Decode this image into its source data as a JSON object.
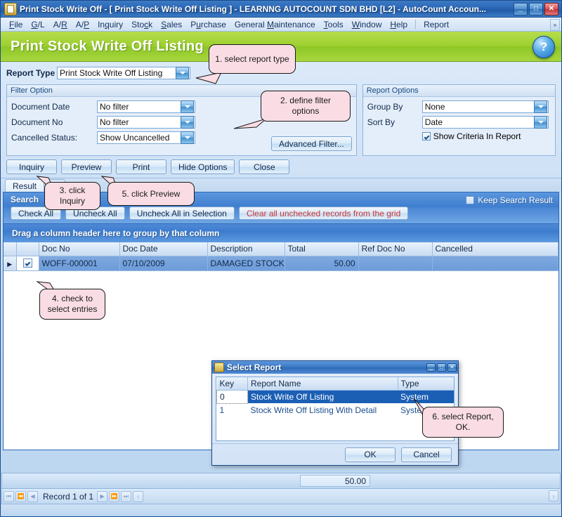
{
  "window": {
    "title": "Print Stock Write Off - [ Print Stock Write Off Listing ] - LEARNNG AUTOCOUNT SDN BHD [L2] - AutoCount Accoun...",
    "icon": "app-document-icon",
    "minimize_label": "_",
    "maximize_label": "□",
    "close_label": "✕"
  },
  "menubar": {
    "items": [
      {
        "label": "File",
        "accel": "F"
      },
      {
        "label": "G/L",
        "accel": "G"
      },
      {
        "label": "A/R",
        "accel": "R"
      },
      {
        "label": "A/P",
        "accel": "P"
      },
      {
        "label": "Inquiry",
        "accel": "q"
      },
      {
        "label": "Stock",
        "accel": "c"
      },
      {
        "label": "Sales",
        "accel": "S"
      },
      {
        "label": "Purchase",
        "accel": "u"
      },
      {
        "label": "General Maintenance",
        "accel": "M"
      },
      {
        "label": "Tools",
        "accel": "T"
      },
      {
        "label": "Window",
        "accel": "W"
      },
      {
        "label": "Help",
        "accel": "H"
      }
    ],
    "after_separator": [
      {
        "label": "Report"
      }
    ],
    "overflow_label": "»"
  },
  "banner": {
    "title": "Print Stock Write Off Listing",
    "help_label": "?",
    "accent_green": "#9ccf2e"
  },
  "report_type": {
    "label": "Report Type",
    "value": "Print Stock Write Off Listing"
  },
  "filter_option": {
    "group_title": "Filter Option",
    "rows": [
      {
        "label": "Document Date",
        "value": "No filter"
      },
      {
        "label": "Document No",
        "value": "No filter"
      },
      {
        "label": "Cancelled Status:",
        "value": "Show Uncancelled"
      }
    ],
    "advanced_button": "Advanced Filter..."
  },
  "report_options": {
    "group_title": "Report Options",
    "rows": [
      {
        "label": "Group By",
        "value": "None"
      },
      {
        "label": "Sort By",
        "value": "Date"
      }
    ],
    "checkbox": {
      "label": "Show Criteria In Report",
      "checked": true
    }
  },
  "action_buttons": [
    {
      "label": "Inquiry"
    },
    {
      "label": "Preview"
    },
    {
      "label": "Print"
    },
    {
      "label": "Hide Options"
    },
    {
      "label": "Close"
    }
  ],
  "tabs": [
    {
      "label": "Result",
      "active": true
    },
    {
      "label": "C",
      "active": false
    }
  ],
  "search_panel": {
    "title": "Search",
    "keep_search_result": {
      "label": "Keep Search Result",
      "checked": false
    },
    "buttons": [
      {
        "label": "Check All",
        "style": "normal"
      },
      {
        "label": "Uncheck All",
        "style": "normal"
      },
      {
        "label": "Uncheck All in Selection",
        "style": "normal"
      },
      {
        "label": "Clear all unchecked records from the grid",
        "style": "danger"
      }
    ],
    "danger_color": "#cc3333"
  },
  "group_bar": {
    "text": "Drag a column header here to group by that column"
  },
  "grid": {
    "columns": [
      "",
      "",
      "Doc No",
      "Doc Date",
      "Description",
      "Total",
      "Ref Doc No",
      "Cancelled"
    ],
    "rows": [
      {
        "indicator": "▶",
        "checked": true,
        "doc_no": "WOFF-000001",
        "doc_date": "07/10/2009",
        "description": "DAMAGED STOCK",
        "total": "50.00",
        "ref_doc_no": "",
        "cancelled": ""
      }
    ]
  },
  "select_report_dialog": {
    "title": "Select Report",
    "icon": "report-document-icon",
    "minimize_label": "_",
    "maximize_label": "□",
    "close_label": "✕",
    "columns": [
      "Key",
      "Report Name",
      "Type"
    ],
    "rows": [
      {
        "key": "0",
        "name": "Stock Write Off Listing",
        "type": "System",
        "selected": true
      },
      {
        "key": "1",
        "name": "Stock Write Off Listing With Detail",
        "type": "System",
        "selected": false
      }
    ],
    "ok_label": "OK",
    "cancel_label": "Cancel"
  },
  "footer": {
    "total_value": "50.00",
    "record_text": "Record 1 of 1",
    "nav_buttons": [
      "⏮",
      "⏪",
      "◀",
      "▶",
      "⏩",
      "⏭",
      "‹"
    ],
    "scroll_right": "›"
  },
  "callouts": [
    {
      "id": "callout-1",
      "text": "1. select report type"
    },
    {
      "id": "callout-2",
      "text": "2. define filter options"
    },
    {
      "id": "callout-3",
      "text": "3. click Inquiry"
    },
    {
      "id": "callout-4",
      "text": "4. check to select entries"
    },
    {
      "id": "callout-5",
      "text": "5. click Preview"
    },
    {
      "id": "callout-6",
      "text": "6. select Report, OK."
    }
  ]
}
